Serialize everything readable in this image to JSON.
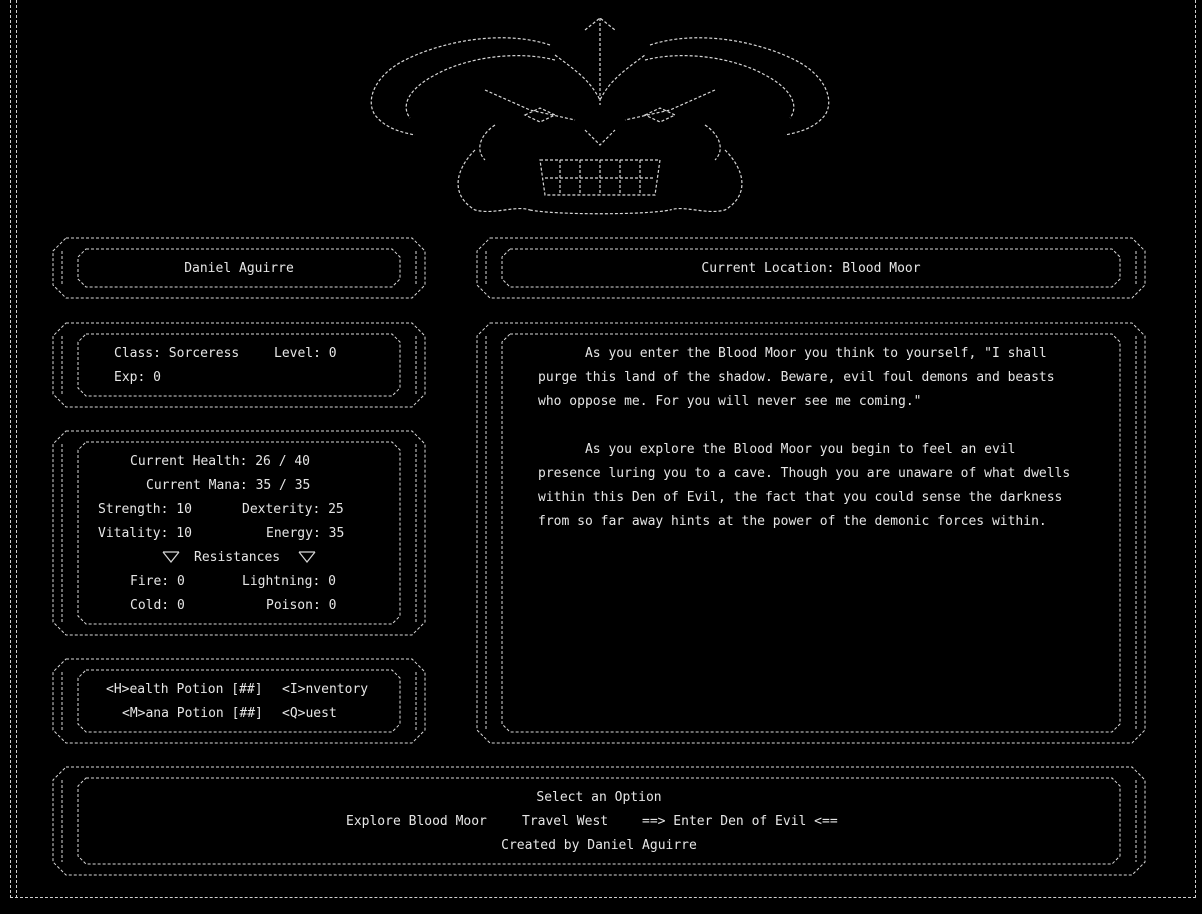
{
  "player": {
    "name": "Daniel Aguirre"
  },
  "location": {
    "label": "Current Location: Blood Moor"
  },
  "character": {
    "class_line": "Class: Sorceress",
    "level_line": "Level: 0",
    "exp_line": "Exp: 0"
  },
  "stats": {
    "health": "Current Health: 26 / 40",
    "mana": "Current Mana: 35 / 35",
    "strength": "Strength: 10",
    "dexterity": "Dexterity: 25",
    "vitality": "Vitality: 10",
    "energy": "Energy: 35",
    "resistances_header": "Resistances",
    "fire": "Fire: 0",
    "lightning": "Lightning: 0",
    "cold": "Cold: 0",
    "poison": "Poison: 0"
  },
  "actions": {
    "health_potion": "<H>ealth Potion [##]",
    "inventory": "<I>nventory",
    "mana_potion": "<M>ana Potion [##]",
    "quest": "<Q>uest"
  },
  "story": {
    "p1_lines": [
      "      As you enter the Blood Moor you think to yourself, \"I shall",
      "purge this land of the shadow. Beware, evil foul demons and beasts",
      "who oppose me. For you will never see me coming.\""
    ],
    "p2_lines": [
      "      As you explore the Blood Moor you begin to feel an evil",
      "presence luring you to a cave. Though you are unaware of what dwells",
      "within this Den of Evil, the fact that you could sense the darkness",
      "from so far away hints at the power of the demonic forces within."
    ]
  },
  "menu": {
    "prompt": "Select an Option",
    "option_1": "Explore Blood Moor",
    "option_2": "Travel West",
    "option_3": "==> Enter Den of Evil <==",
    "credit": "Created by Daniel Aguirre"
  }
}
